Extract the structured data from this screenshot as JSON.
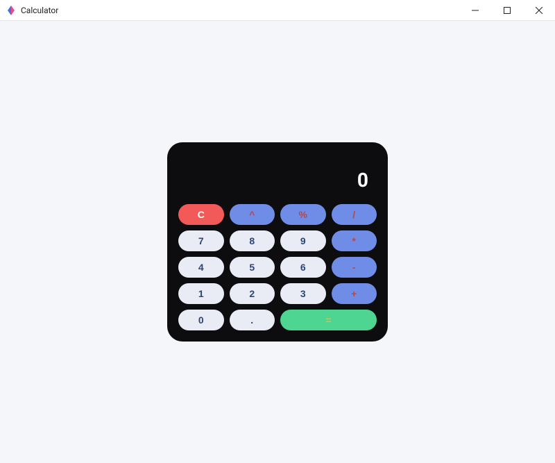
{
  "window": {
    "title": "Calculator"
  },
  "calculator": {
    "display": "0",
    "keys": {
      "clear": "C",
      "power": "^",
      "percent": "%",
      "divide": "/",
      "seven": "7",
      "eight": "8",
      "nine": "9",
      "multiply": "*",
      "four": "4",
      "five": "5",
      "six": "6",
      "minus": "-",
      "one": "1",
      "two": "2",
      "three": "3",
      "plus": "+",
      "zero": "0",
      "decimal": ".",
      "equals": "="
    }
  }
}
